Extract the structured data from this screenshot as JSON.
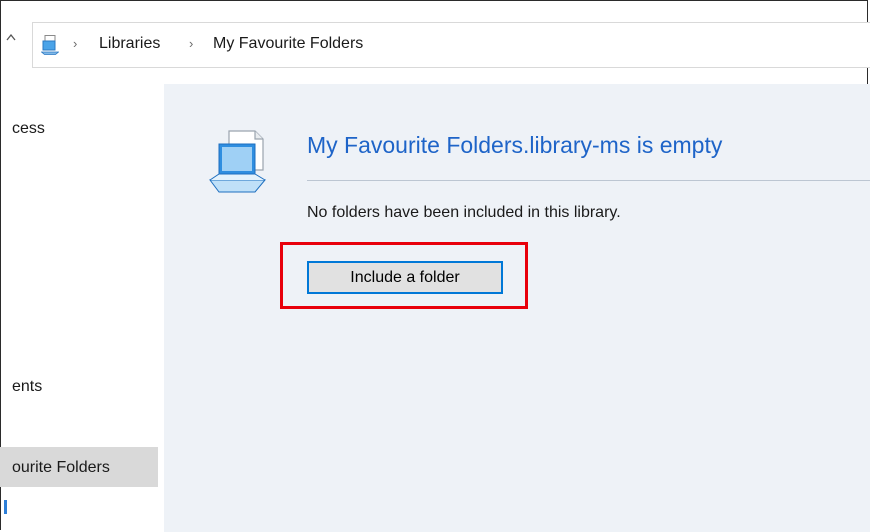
{
  "address_bar": {
    "breadcrumbs": [
      "Libraries",
      "My Favourite Folders"
    ]
  },
  "nav_pane": {
    "items": [
      {
        "label": "cess"
      },
      {
        "label": "ents"
      },
      {
        "label": "ourite Folders",
        "selected": true
      }
    ]
  },
  "content": {
    "empty_title": "My Favourite Folders.library-ms is empty",
    "empty_description": "No folders have been included in this library.",
    "include_button_label": "Include a folder"
  },
  "colors": {
    "title_blue": "#1e64c8",
    "content_bg": "#eef2f7",
    "highlight_red": "#e8000b",
    "button_border": "#0078d7"
  }
}
